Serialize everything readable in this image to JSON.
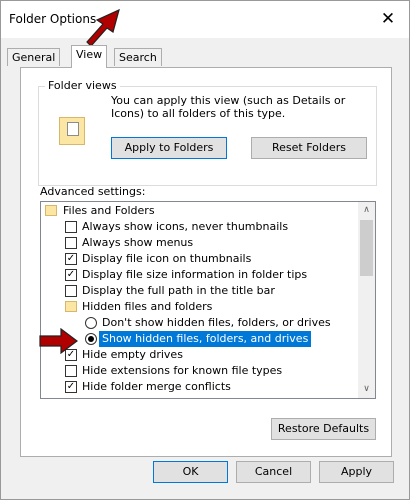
{
  "window": {
    "title": "Folder Options",
    "close_symbol": "✕"
  },
  "tabs": [
    {
      "label": "General"
    },
    {
      "label": "View"
    },
    {
      "label": "Search"
    }
  ],
  "folder_views": {
    "title": "Folder views",
    "description": "You can apply this view (such as Details or Icons) to all folders of this type.",
    "apply_label": "Apply to Folders",
    "reset_label": "Reset Folders"
  },
  "advanced": {
    "label": "Advanced settings:",
    "items": [
      {
        "label": "Files and Folders",
        "type": "folder",
        "level": 0
      },
      {
        "label": "Always show icons, never thumbnails",
        "type": "checkbox",
        "checked": false,
        "level": 1
      },
      {
        "label": "Always show menus",
        "type": "checkbox",
        "checked": false,
        "level": 1
      },
      {
        "label": "Display file icon on thumbnails",
        "type": "checkbox",
        "checked": true,
        "level": 1
      },
      {
        "label": "Display file size information in folder tips",
        "type": "checkbox",
        "checked": true,
        "level": 1
      },
      {
        "label": "Display the full path in the title bar",
        "type": "checkbox",
        "checked": false,
        "level": 1
      },
      {
        "label": "Hidden files and folders",
        "type": "folder",
        "level": 1
      },
      {
        "label": "Don't show hidden files, folders, or drives",
        "type": "radio",
        "checked": false,
        "level": 2
      },
      {
        "label": "Show hidden files, folders, and drives",
        "type": "radio",
        "checked": true,
        "selected": true,
        "level": 2
      },
      {
        "label": "Hide empty drives",
        "type": "checkbox",
        "checked": true,
        "level": 1
      },
      {
        "label": "Hide extensions for known file types",
        "type": "checkbox",
        "checked": false,
        "level": 1
      },
      {
        "label": "Hide folder merge conflicts",
        "type": "checkbox",
        "checked": true,
        "level": 1
      }
    ],
    "scroll_up_symbol": "∧",
    "scroll_down_symbol": "∨"
  },
  "restore_label": "Restore Defaults",
  "footer": {
    "ok_label": "OK",
    "cancel_label": "Cancel",
    "apply_label": "Apply"
  },
  "colors": {
    "selection": "#0078d7",
    "annotation_arrow": "#b00000"
  },
  "icons": {
    "close": "close-icon",
    "folder": "folder-icon",
    "annotation": "red-arrow-icon"
  }
}
